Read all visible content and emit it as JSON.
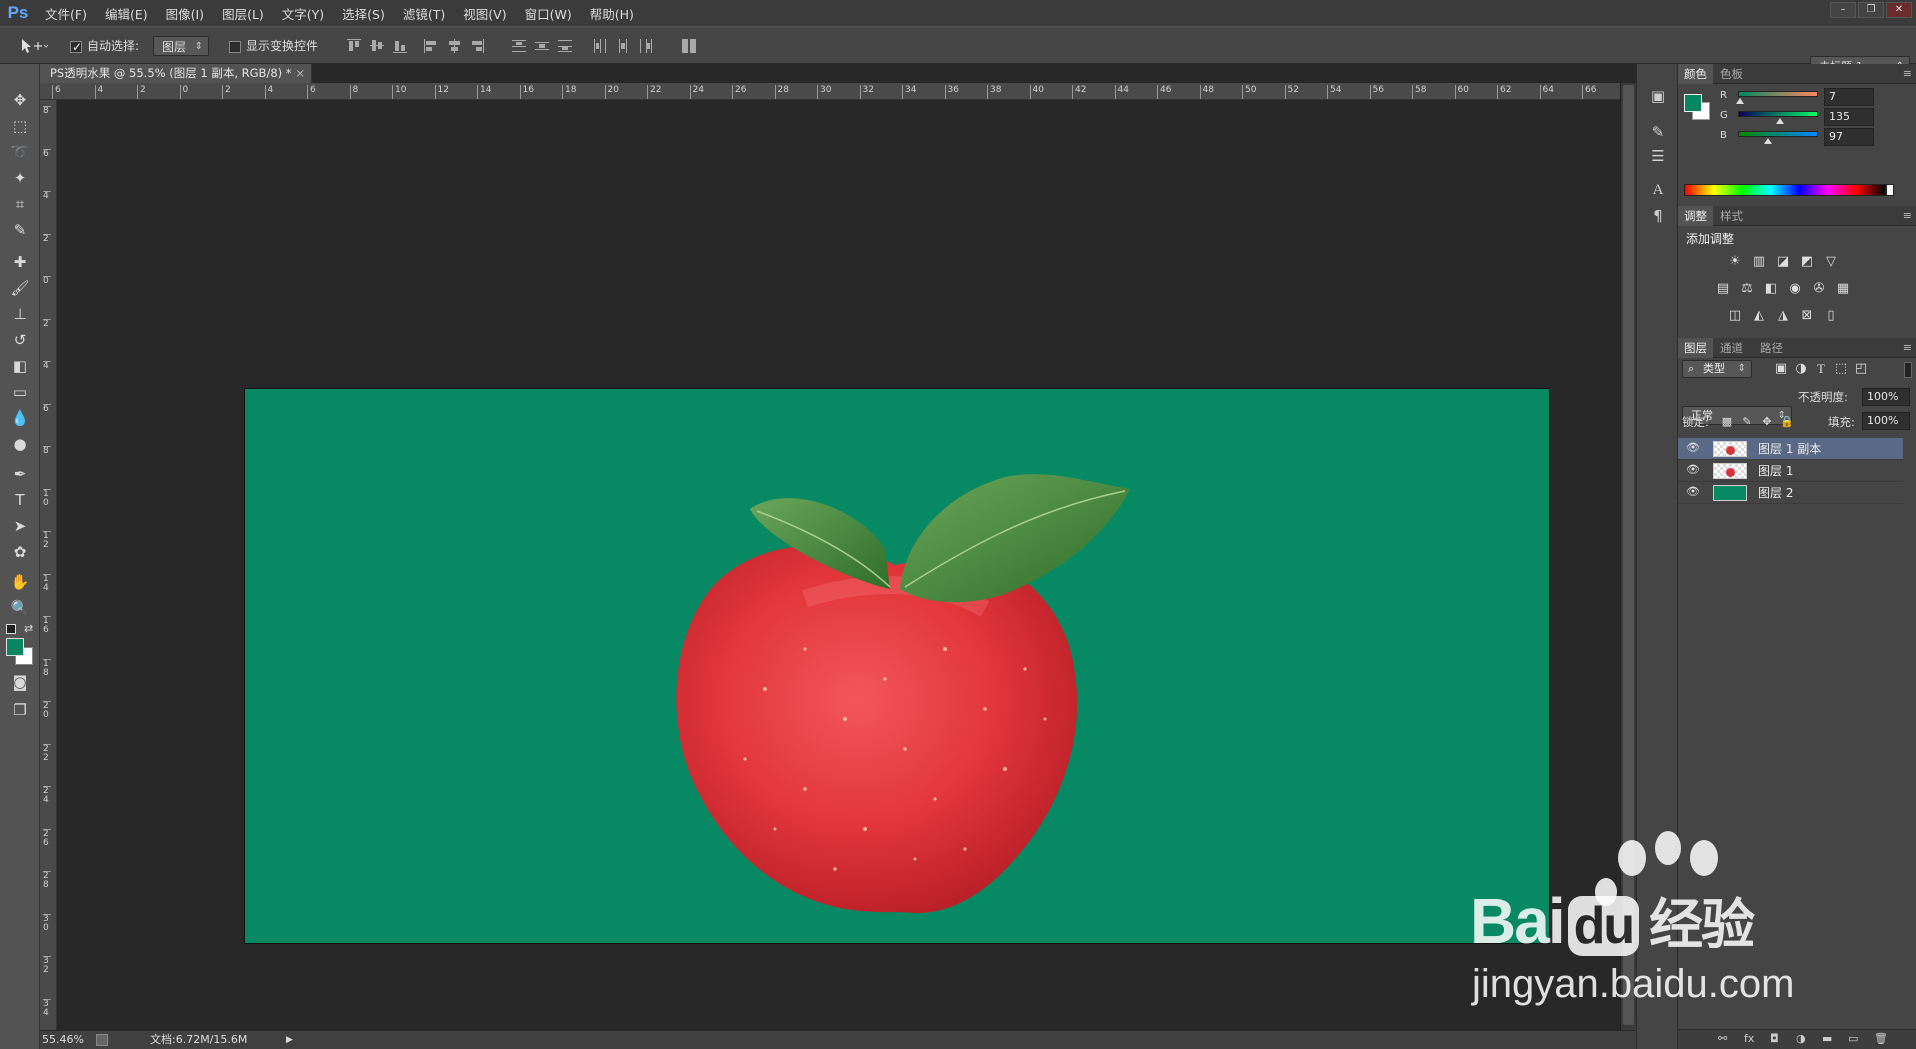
{
  "app": {
    "logo": "Ps"
  },
  "menu": [
    "文件(F)",
    "编辑(E)",
    "图像(I)",
    "图层(L)",
    "文字(Y)",
    "选择(S)",
    "滤镜(T)",
    "视图(V)",
    "窗口(W)",
    "帮助(H)"
  ],
  "window_controls": [
    "–",
    "❐",
    "✕"
  ],
  "options": {
    "auto_select_label": "自动选择:",
    "auto_select_checked": true,
    "auto_select_target": "图层",
    "show_transform_label": "显示变换控件",
    "show_transform_checked": false,
    "workspace": "未标题-1"
  },
  "document": {
    "tab_title": "PS透明水果 @ 55.5% (图层 1 副本, RGB/8) *",
    "close": "×",
    "background_color": "#078963"
  },
  "ruler": {
    "h_labels": [
      "6",
      "4",
      "2",
      "0",
      "2",
      "4",
      "6",
      "8",
      "10",
      "12",
      "14",
      "16",
      "18",
      "20",
      "22",
      "24",
      "26",
      "28",
      "30",
      "32",
      "34",
      "36",
      "38",
      "40",
      "42",
      "44",
      "46",
      "48",
      "50",
      "52",
      "54",
      "56",
      "58",
      "60",
      "62",
      "64",
      "66"
    ],
    "v_labels": [
      "8",
      "6",
      "4",
      "2",
      "0",
      "2",
      "4",
      "6",
      "8",
      "10",
      "12",
      "14",
      "16",
      "18",
      "20",
      "22",
      "24",
      "26",
      "28",
      "30",
      "32",
      "34"
    ]
  },
  "status": {
    "zoom": "55.46%",
    "doc_size": "文档:6.72M/15.6M",
    "arrow": "▶"
  },
  "color_panel": {
    "tabs": [
      "颜色",
      "色板"
    ],
    "fg_color": "#078761",
    "bg_color": "#ffffff",
    "channels": [
      {
        "label": "R",
        "value": "7",
        "level": 0.027
      },
      {
        "label": "G",
        "value": "135",
        "level": 0.53
      },
      {
        "label": "B",
        "value": "97",
        "level": 0.38
      }
    ]
  },
  "adjustments_panel": {
    "tabs": [
      "调整",
      "样式"
    ],
    "heading": "添加调整"
  },
  "layers_panel": {
    "tabs": [
      "图层",
      "通道",
      "路径"
    ],
    "filter_kind": "类型",
    "blend_mode": "正常",
    "opacity_label": "不透明度:",
    "opacity_value": "100%",
    "lock_label": "锁定:",
    "fill_label": "填充:",
    "fill_value": "100%",
    "layers": [
      {
        "name": "图层 1 副本",
        "selected": true,
        "thumb": "apple"
      },
      {
        "name": "图层 1",
        "selected": false,
        "thumb": "apple"
      },
      {
        "name": "图层 2",
        "selected": false,
        "thumb": "green"
      }
    ],
    "bottom_icons": [
      "⚯",
      "fx",
      "◘",
      "◑",
      "▬",
      "▭",
      "🗑"
    ]
  },
  "watermark": {
    "brand": "Bai",
    "brand2": "du",
    "product": "经验",
    "url": "jingyan.baidu.com"
  }
}
